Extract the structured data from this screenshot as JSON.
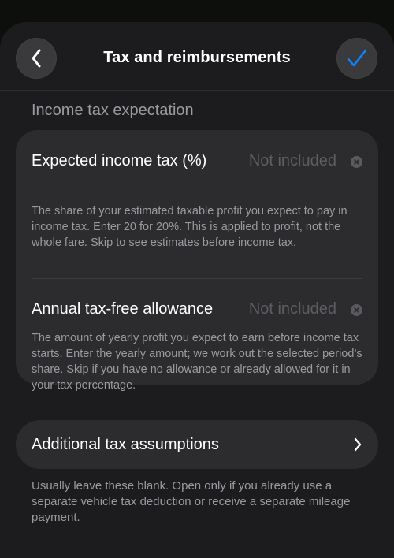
{
  "nav": {
    "title": "Tax and reimbursements",
    "back_icon": "chevron-left-icon",
    "done_icon": "checkmark-icon",
    "accent_color": "#0a84ff"
  },
  "section": {
    "title": "Income tax expectation"
  },
  "fields": [
    {
      "label": "Expected income tax (%)",
      "value": "Not included",
      "description": "The share of your estimated taxable profit you expect to pay in income tax. Enter 20 for 20%. This is applied to profit, not the whole fare. Skip to see estimates before income tax."
    },
    {
      "label": "Annual tax-free allowance",
      "value": "Not included",
      "description": "The amount of yearly profit you expect to earn before income tax starts. Enter the yearly amount; we work out the selected period’s share. Skip if you have no allowance or already allowed for it in your tax percentage."
    }
  ],
  "additional": {
    "label": "Additional tax assumptions",
    "icon": "chevron-right-icon",
    "note": "Usually leave these blank. Open only if you already use a separate vehicle tax deduction or receive a separate mileage payment."
  }
}
